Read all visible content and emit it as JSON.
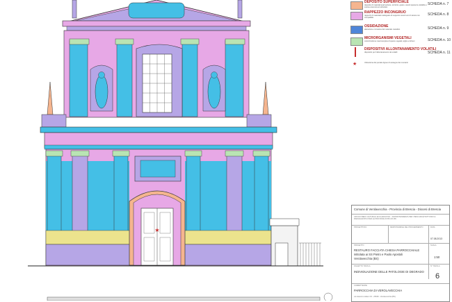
{
  "legend": {
    "items": [
      {
        "title": "DEPOSITO SUPERFICIALE",
        "desc": "deposito di materiali quali polvere, terriccio, guano, aventi spessore variabile e scarsa coerenza al substrato",
        "ref": "SCHEDA n. 7",
        "color": "#f5b58f"
      },
      {
        "title": "RAPPEZZO INCONGRUO",
        "desc": "rappezzi di materiale inadeguato di supporto recenti e/o di natura non compatibile",
        "ref": "SCHEDA n. 8",
        "color": "#e7a8e6"
      },
      {
        "title": "OSSIDAZIONE",
        "desc": "alterazione cromatica del materiale metallico",
        "ref": "SCHEDA n. 9",
        "color": "#4f86d9"
      },
      {
        "title": "MICRORGANISMI VEGETALI",
        "desc": "colonizzazione macroscopica di specie vegetali, alghe e licheni",
        "ref": "SCHEDA n. 10",
        "color": "#b9e4b3"
      },
      {
        "title": "DISPOSITIVI ALLONTANAMENTO VOLATILI",
        "desc": "dispositivi per l'allontanamento dei volatili",
        "ref": "SCHEDA n. 11",
        "color": "#c62d2d"
      }
    ],
    "star_note": "Ubicazione del puntale ligneo di sostegno dei montanti"
  },
  "title_block": {
    "header": "Comune di Verolavecchia - Provincia di Brescia - Diocesi di Brescia",
    "office": "UFFICIO BENI CULTURALI ECCLESIASTICI - SOPRINTENDENZA PER I BENI ARCHITETTONICI E PAESAGGISTICI PER LE PROVINCE DI BS CR MN",
    "label_progettisti": "PROGETTISTA",
    "label_responsabile": "RESPONSABILE DEL PROCEDIMENTO",
    "label_data": "DATA",
    "date": "07.08.2013",
    "label_progetto": "PROGETTO",
    "project": "RESTAURO FACCIATA CHIESA PARROCCHIALE",
    "project_sub1": "intitolata ai SS Pietro e Paolo Apostoli",
    "project_sub2": "Verolavecchia (BS)",
    "label_scala": "SCALA",
    "scale": "1:50",
    "label_oggetto": "OGGETTO TAVOLA",
    "subject": "INDIVIDUAZIONE DELLE PATOLOGIE DI DEGRADO",
    "label_tavola": "N° TAVOLA",
    "sheet": "6",
    "label_committente": "COMMITTENTE",
    "client": "PARROCCHIA DI VEROLAVECCHIA",
    "client_addr": "via Giacomo Adami 15 - 25028 - Verolavecchia (BS)"
  },
  "colors": {
    "pink": "#e7a8e6",
    "cyan": "#44bfe6",
    "blue": "#4f86d9",
    "lavender": "#b6a6e6",
    "yellow": "#ece38d",
    "green": "#b9e4b3",
    "red": "#c62d2d"
  }
}
